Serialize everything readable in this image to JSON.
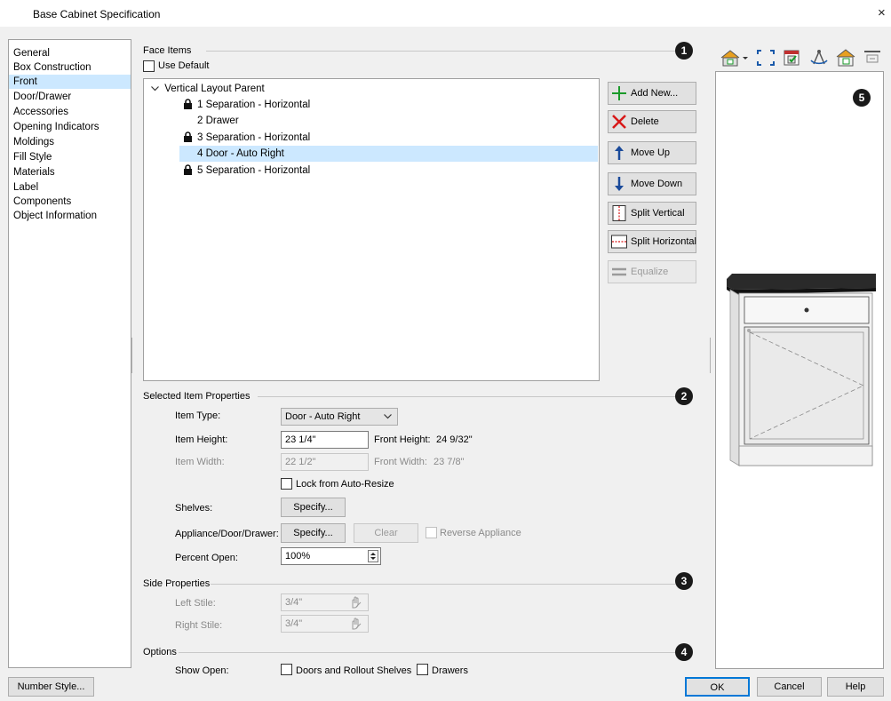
{
  "window": {
    "title": "Base Cabinet Specification",
    "close_glyph": "×"
  },
  "nav": {
    "items": [
      "General",
      "Box Construction",
      "Front",
      "Door/Drawer",
      "Accessories",
      "Opening Indicators",
      "Moldings",
      "Fill Style",
      "Materials",
      "Label",
      "Components",
      "Object Information"
    ],
    "selected": "Front"
  },
  "face_items": {
    "title": "Face Items",
    "badge": "1",
    "use_default_label": "Use Default",
    "use_default_checked": false,
    "tree": {
      "root": "Vertical Layout Parent",
      "items": [
        {
          "label": "1 Separation - Horizontal",
          "locked": true
        },
        {
          "label": "2 Drawer",
          "locked": false
        },
        {
          "label": "3 Separation - Horizontal",
          "locked": true
        },
        {
          "label": "4 Door - Auto Right",
          "locked": false,
          "selected": true
        },
        {
          "label": "5 Separation - Horizontal",
          "locked": true
        }
      ]
    },
    "buttons": {
      "add_new": "Add New...",
      "delete": "Delete",
      "move_up": "Move Up",
      "move_down": "Move Down",
      "split_vertical": "Split Vertical",
      "split_horizontal": "Split Horizontal",
      "equalize": "Equalize"
    }
  },
  "selected_item": {
    "title": "Selected Item Properties",
    "badge": "2",
    "item_type_label": "Item Type:",
    "item_type_value": "Door - Auto Right",
    "item_height_label": "Item Height:",
    "item_height_value": "23 1/4\"",
    "front_height_label": "Front Height:",
    "front_height_value": "24 9/32\"",
    "item_width_label": "Item Width:",
    "item_width_value": "22 1/2\"",
    "front_width_label": "Front Width:",
    "front_width_value": "23 7/8\"",
    "lock_label": "Lock from Auto-Resize",
    "lock_checked": false,
    "shelves_label": "Shelves:",
    "specify_label": "Specify...",
    "appliance_label": "Appliance/Door/Drawer:",
    "clear_label": "Clear",
    "reverse_label": "Reverse Appliance",
    "percent_open_label": "Percent Open:",
    "percent_open_value": "100%"
  },
  "side_properties": {
    "title": "Side Properties",
    "badge": "3",
    "left_stile_label": "Left Stile:",
    "left_stile_value": "3/4\"",
    "right_stile_label": "Right Stile:",
    "right_stile_value": "3/4\""
  },
  "options": {
    "title": "Options",
    "badge": "4",
    "show_open_label": "Show Open:",
    "doors_label": "Doors and Rollout Shelves",
    "drawers_label": "Drawers",
    "doors_checked": false,
    "drawers_checked": false
  },
  "preview": {
    "badge": "5"
  },
  "footer": {
    "number_style": "Number Style...",
    "ok": "OK",
    "cancel": "Cancel",
    "help": "Help"
  },
  "colors": {
    "selection": "#cce8ff",
    "badge": "#1a1a1a",
    "countertop": "#2a2a2a"
  }
}
